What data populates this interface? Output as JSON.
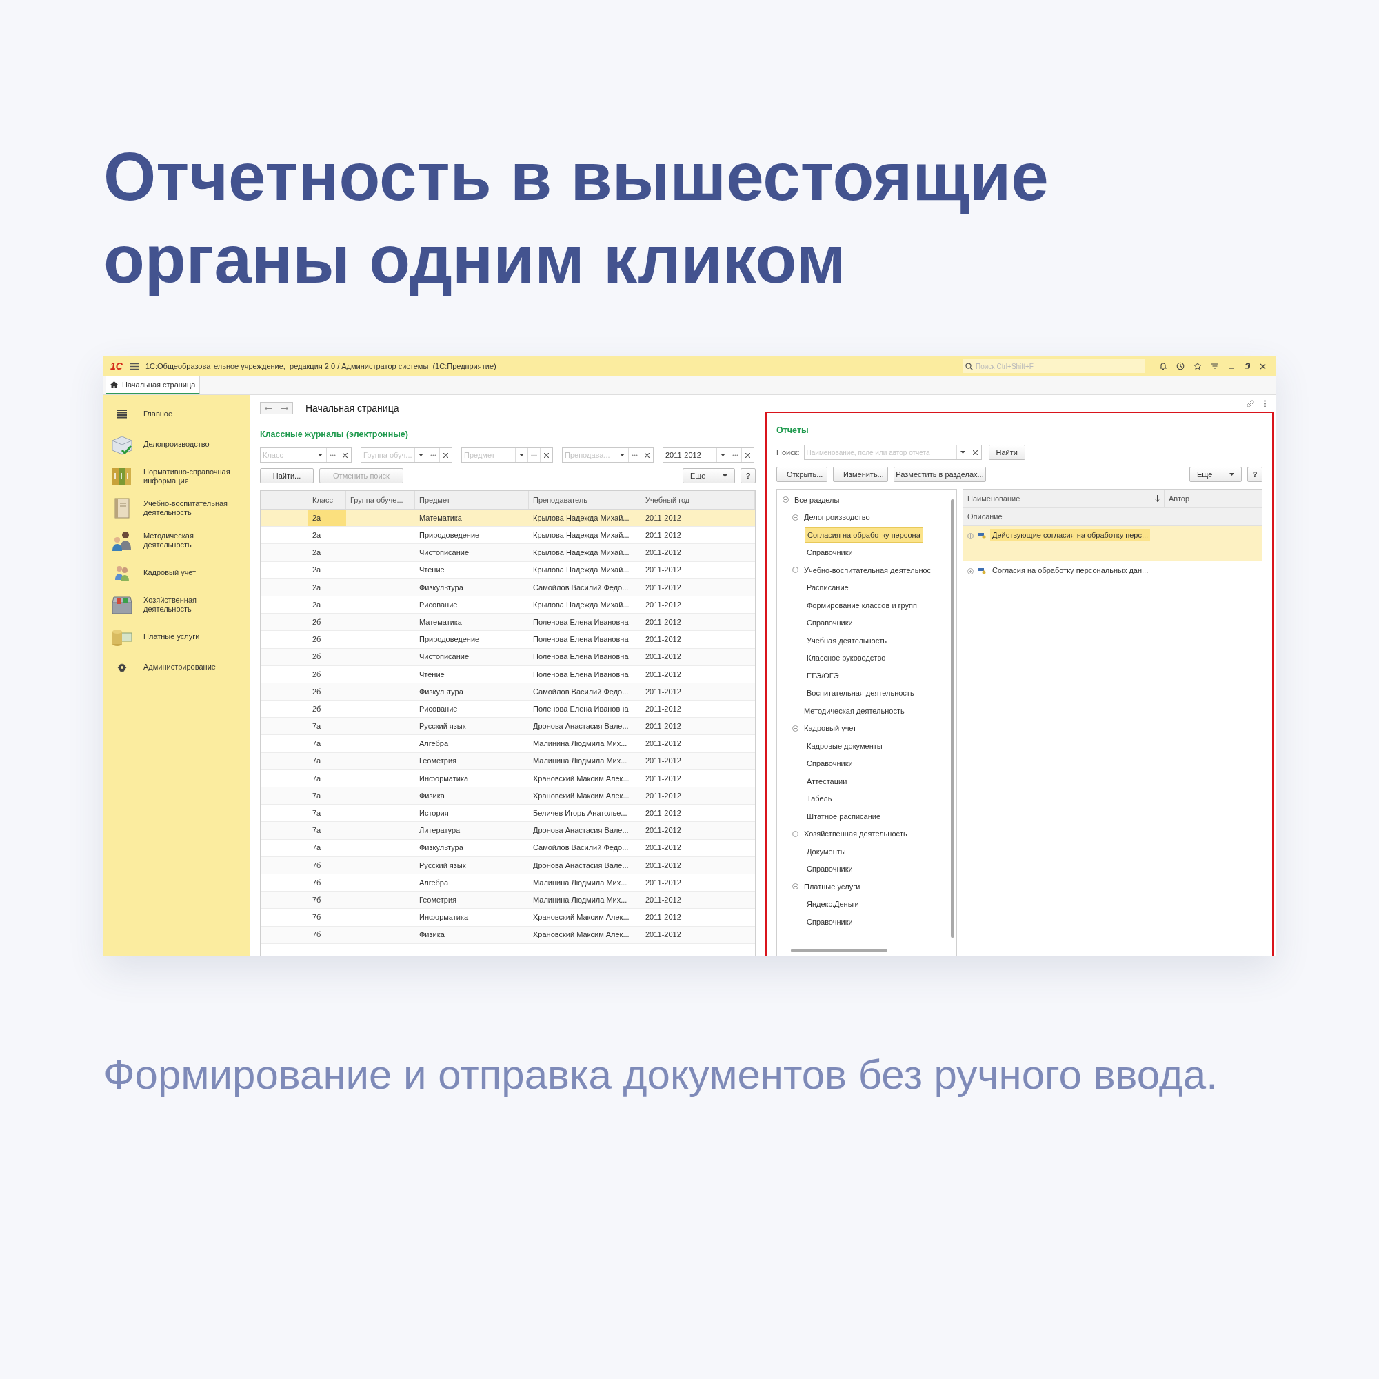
{
  "headline": "Отчетность в вышестоящие органы одним кликом",
  "subtitle": "Формирование и отправка документов без ручного ввода.",
  "app": {
    "logo": "1С",
    "title": "1С:Общеобразовательное учреждение,  редакция 2.0 / Администратор системы  (1С:Предприятие)",
    "search_placeholder": "Поиск Ctrl+Shift+F",
    "tabs": [
      {
        "label": "Начальная страница",
        "selected": true
      }
    ],
    "sidebar": [
      {
        "label": "Главное"
      },
      {
        "label": "Делопроизводство"
      },
      {
        "label": "Нормативно-справочная информация"
      },
      {
        "label": "Учебно-воспитательная деятельность"
      },
      {
        "label": "Методическая деятельность"
      },
      {
        "label": "Кадровый учет"
      },
      {
        "label": "Хозяйственная деятельность"
      },
      {
        "label": "Платные услуги"
      },
      {
        "label": "Администрирование"
      }
    ],
    "page_title": "Начальная страница",
    "journals": {
      "title": "Классные журналы (электронные)",
      "filters": [
        {
          "placeholder": "Класс"
        },
        {
          "placeholder": "Группа обуч..."
        },
        {
          "placeholder": "Предмет"
        },
        {
          "placeholder": "Преподава..."
        },
        {
          "value": "2011-2012"
        }
      ],
      "buttons": [
        {
          "label": "Найти...",
          "disabled": false
        },
        {
          "label": "Отменить поиск",
          "disabled": true
        }
      ],
      "more": "Еще",
      "help": "?",
      "columns": [
        "Класс",
        "Группа обуче...",
        "Предмет",
        "Преподаватель",
        "Учебный год"
      ],
      "rows": [
        {
          "class": "2а",
          "subject": "Математика",
          "teacher": "Крылова Надежда Михай...",
          "year": "2011-2012",
          "selected": true
        },
        {
          "class": "2а",
          "subject": "Природоведение",
          "teacher": "Крылова Надежда Михай...",
          "year": "2011-2012",
          "selected": false
        },
        {
          "class": "2а",
          "subject": "Чистописание",
          "teacher": "Крылова Надежда Михай...",
          "year": "2011-2012",
          "selected": false
        },
        {
          "class": "2а",
          "subject": "Чтение",
          "teacher": "Крылова Надежда Михай...",
          "year": "2011-2012",
          "selected": false
        },
        {
          "class": "2а",
          "subject": "Физкультура",
          "teacher": "Самойлов Василий Федо...",
          "year": "2011-2012",
          "selected": false
        },
        {
          "class": "2а",
          "subject": "Рисование",
          "teacher": "Крылова Надежда Михай...",
          "year": "2011-2012",
          "selected": false
        },
        {
          "class": "2б",
          "subject": "Математика",
          "teacher": "Поленова Елена Ивановна",
          "year": "2011-2012",
          "selected": false
        },
        {
          "class": "2б",
          "subject": "Природоведение",
          "teacher": "Поленова Елена Ивановна",
          "year": "2011-2012",
          "selected": false
        },
        {
          "class": "2б",
          "subject": "Чистописание",
          "teacher": "Поленова Елена Ивановна",
          "year": "2011-2012",
          "selected": false
        },
        {
          "class": "2б",
          "subject": "Чтение",
          "teacher": "Поленова Елена Ивановна",
          "year": "2011-2012",
          "selected": false
        },
        {
          "class": "2б",
          "subject": "Физкультура",
          "teacher": "Самойлов Василий Федо...",
          "year": "2011-2012",
          "selected": false
        },
        {
          "class": "2б",
          "subject": "Рисование",
          "teacher": "Поленова Елена Ивановна",
          "year": "2011-2012",
          "selected": false
        },
        {
          "class": "7а",
          "subject": "Русский язык",
          "teacher": "Дронова Анастасия Вале...",
          "year": "2011-2012",
          "selected": false
        },
        {
          "class": "7а",
          "subject": "Алгебра",
          "teacher": "Малинина Людмила Мих...",
          "year": "2011-2012",
          "selected": false
        },
        {
          "class": "7а",
          "subject": "Геометрия",
          "teacher": "Малинина Людмила Мих...",
          "year": "2011-2012",
          "selected": false
        },
        {
          "class": "7а",
          "subject": "Информатика",
          "teacher": "Храновский Максим Алек...",
          "year": "2011-2012",
          "selected": false
        },
        {
          "class": "7а",
          "subject": "Физика",
          "teacher": "Храновский Максим Алек...",
          "year": "2011-2012",
          "selected": false
        },
        {
          "class": "7а",
          "subject": "История",
          "teacher": "Беличев Игорь Анатолье...",
          "year": "2011-2012",
          "selected": false
        },
        {
          "class": "7а",
          "subject": "Литература",
          "teacher": "Дронова Анастасия Вале...",
          "year": "2011-2012",
          "selected": false
        },
        {
          "class": "7а",
          "subject": "Физкультура",
          "teacher": "Самойлов Василий Федо...",
          "year": "2011-2012",
          "selected": false
        },
        {
          "class": "7б",
          "subject": "Русский язык",
          "teacher": "Дронова Анастасия Вале...",
          "year": "2011-2012",
          "selected": false
        },
        {
          "class": "7б",
          "subject": "Алгебра",
          "teacher": "Малинина Людмила Мих...",
          "year": "2011-2012",
          "selected": false
        },
        {
          "class": "7б",
          "subject": "Геометрия",
          "teacher": "Малинина Людмила Мих...",
          "year": "2011-2012",
          "selected": false
        },
        {
          "class": "7б",
          "subject": "Информатика",
          "teacher": "Храновский Максим Алек...",
          "year": "2011-2012",
          "selected": false
        },
        {
          "class": "7б",
          "subject": "Физика",
          "teacher": "Храновский Максим Алек...",
          "year": "2011-2012",
          "selected": false
        }
      ]
    },
    "reports": {
      "title": "Отчеты",
      "search_label": "Поиск:",
      "search_placeholder": "Наименование, поле или автор отчета",
      "find": "Найти",
      "actions": [
        "Открыть...",
        "Изменить...",
        "Разместить в разделах..."
      ],
      "more": "Еще",
      "help": "?",
      "tree": [
        {
          "label": "Все разделы",
          "selected": false,
          "expanded": true,
          "children": [
            {
              "label": "Делопроизводство",
              "selected": false,
              "expanded": true,
              "children": [
                {
                  "label": "Согласия на обработку персона",
                  "selected": true
                },
                {
                  "label": "Справочники",
                  "selected": false
                }
              ]
            },
            {
              "label": "Учебно-воспитательная деятельнос",
              "selected": false,
              "expanded": true,
              "children": [
                {
                  "label": "Расписание",
                  "selected": false
                },
                {
                  "label": "Формирование классов и групп",
                  "selected": false
                },
                {
                  "label": "Справочники",
                  "selected": false
                },
                {
                  "label": "Учебная деятельность",
                  "selected": false
                },
                {
                  "label": "Классное руководство",
                  "selected": false
                },
                {
                  "label": "ЕГЭ/ОГЭ",
                  "selected": false
                },
                {
                  "label": "Воспитательная деятельность",
                  "selected": false
                }
              ]
            },
            {
              "label": "Методическая деятельность",
              "selected": false
            },
            {
              "label": "Кадровый учет",
              "selected": false,
              "expanded": true,
              "children": [
                {
                  "label": "Кадровые документы",
                  "selected": false
                },
                {
                  "label": "Справочники",
                  "selected": false
                },
                {
                  "label": "Аттестации",
                  "selected": false
                },
                {
                  "label": "Табель",
                  "selected": false
                },
                {
                  "label": "Штатное расписание",
                  "selected": false
                }
              ]
            },
            {
              "label": "Хозяйственная деятельность",
              "selected": false,
              "expanded": true,
              "children": [
                {
                  "label": "Документы",
                  "selected": false
                },
                {
                  "label": "Справочники",
                  "selected": false
                }
              ]
            },
            {
              "label": "Платные услуги",
              "selected": false,
              "expanded": true,
              "children": [
                {
                  "label": "Яндекс.Деньги",
                  "selected": false
                },
                {
                  "label": "Справочники",
                  "selected": false
                }
              ]
            }
          ]
        }
      ],
      "columns": [
        "Наименование",
        "Автор"
      ],
      "subheader": "Описание",
      "items": [
        {
          "name": "Действующие согласия на обработку перс...",
          "selected": true
        },
        {
          "name": "Согласия на обработку персональных дан...",
          "selected": false
        }
      ]
    }
  }
}
